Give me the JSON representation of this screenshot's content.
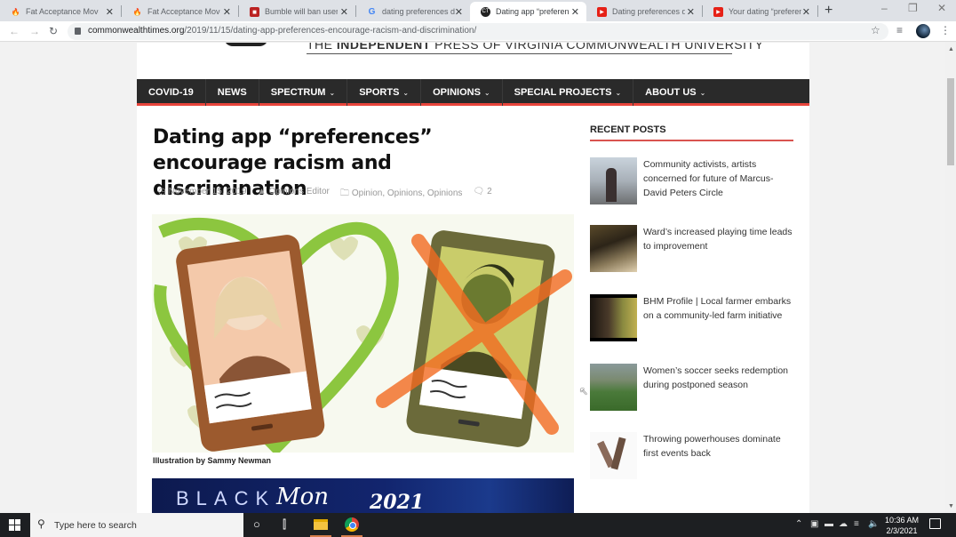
{
  "browser": {
    "tabs": [
      {
        "title": "Fat Acceptance Moveme",
        "icon": "green-flame-icon",
        "active": false
      },
      {
        "title": "Fat Acceptance Moveme",
        "icon": "green-flame-icon",
        "active": false
      },
      {
        "title": "Bumble will ban users",
        "icon": "red-square-icon",
        "active": false
      },
      {
        "title": "dating preferences dis",
        "icon": "google-icon",
        "active": false
      },
      {
        "title": "Dating app “preferenc",
        "icon": "ct-icon",
        "active": true
      },
      {
        "title": "Dating preferences dis",
        "icon": "youtube-icon",
        "active": false
      },
      {
        "title": "Your dating “preferenc",
        "icon": "youtube-icon",
        "active": false
      }
    ],
    "new_tab_label": "+",
    "url_domain": "commonwealthtimes.org",
    "url_path": "/2019/11/15/dating-app-preferences-encourage-racism-and-discrimination/"
  },
  "site": {
    "tagline_prefix": "THE ",
    "tagline_bold": "INDEPENDENT",
    "tagline_suffix": " PRESS OF VIRGINIA COMMONWEALTH UNIVERSITY",
    "accent_color": "#e8453c",
    "nav": [
      {
        "label": "COVID-19",
        "dropdown": false
      },
      {
        "label": "NEWS",
        "dropdown": false
      },
      {
        "label": "SPECTRUM",
        "dropdown": true
      },
      {
        "label": "SPORTS",
        "dropdown": true
      },
      {
        "label": "OPINIONS",
        "dropdown": true
      },
      {
        "label": "SPECIAL PROJECTS",
        "dropdown": true
      },
      {
        "label": "ABOUT US",
        "dropdown": true
      }
    ]
  },
  "article": {
    "title": "Dating app “preferences” encourage racism and discrimination",
    "date": "November 15, 2019",
    "author": "Opinions Editor",
    "categories": "Opinion, Opinions, Opinions",
    "comments": "2",
    "image_caption": "Illustration by Sammy Newman",
    "banner_text_1": "BLACK",
    "banner_text_2": "Mon",
    "banner_text_3": "2021"
  },
  "sidebar": {
    "title": "RECENT POSTS",
    "posts": [
      {
        "title": "Community activists, artists concerned for future of Marcus-David Peters Circle"
      },
      {
        "title": "Ward’s increased playing time leads to improvement"
      },
      {
        "title": "BHM Profile | Local farmer embarks on a community-led farm initiative"
      },
      {
        "title": "Women’s soccer seeks redemption during postponed season"
      },
      {
        "title": "Throwing powerhouses dominate first events back"
      }
    ]
  },
  "taskbar": {
    "search_placeholder": "Type here to search",
    "time": "10:36 AM",
    "date": "2/3/2021"
  }
}
